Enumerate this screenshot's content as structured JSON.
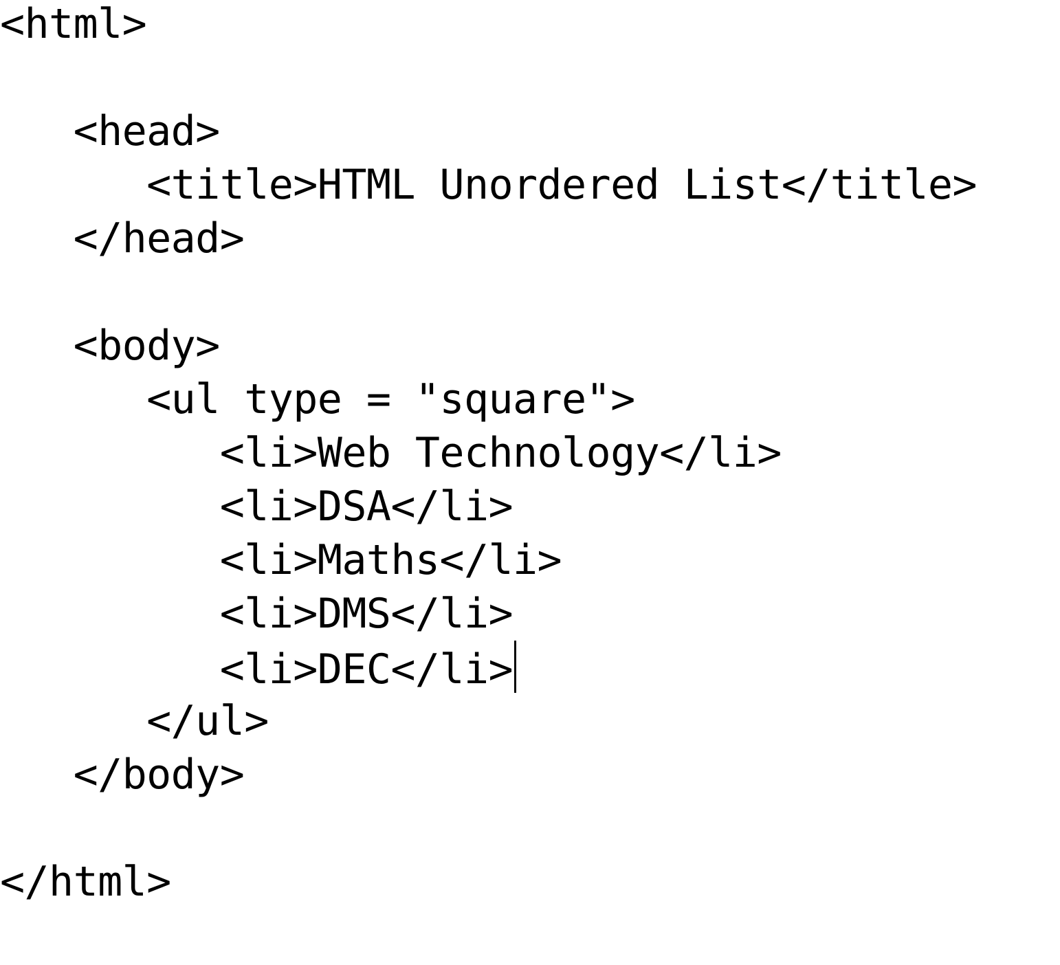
{
  "editor": {
    "lines": [
      "<html>",
      "",
      "   <head>",
      "      <title>HTML Unordered List</title>",
      "   </head>",
      "",
      "   <body>",
      "      <ul type = \"square\">",
      "         <li>Web Technology</li>",
      "         <li>DSA</li>",
      "         <li>Maths</li>",
      "         <li>DMS</li>",
      "         <li>DEC</li>",
      "      </ul>",
      "   </body>",
      "",
      "</html>"
    ]
  }
}
